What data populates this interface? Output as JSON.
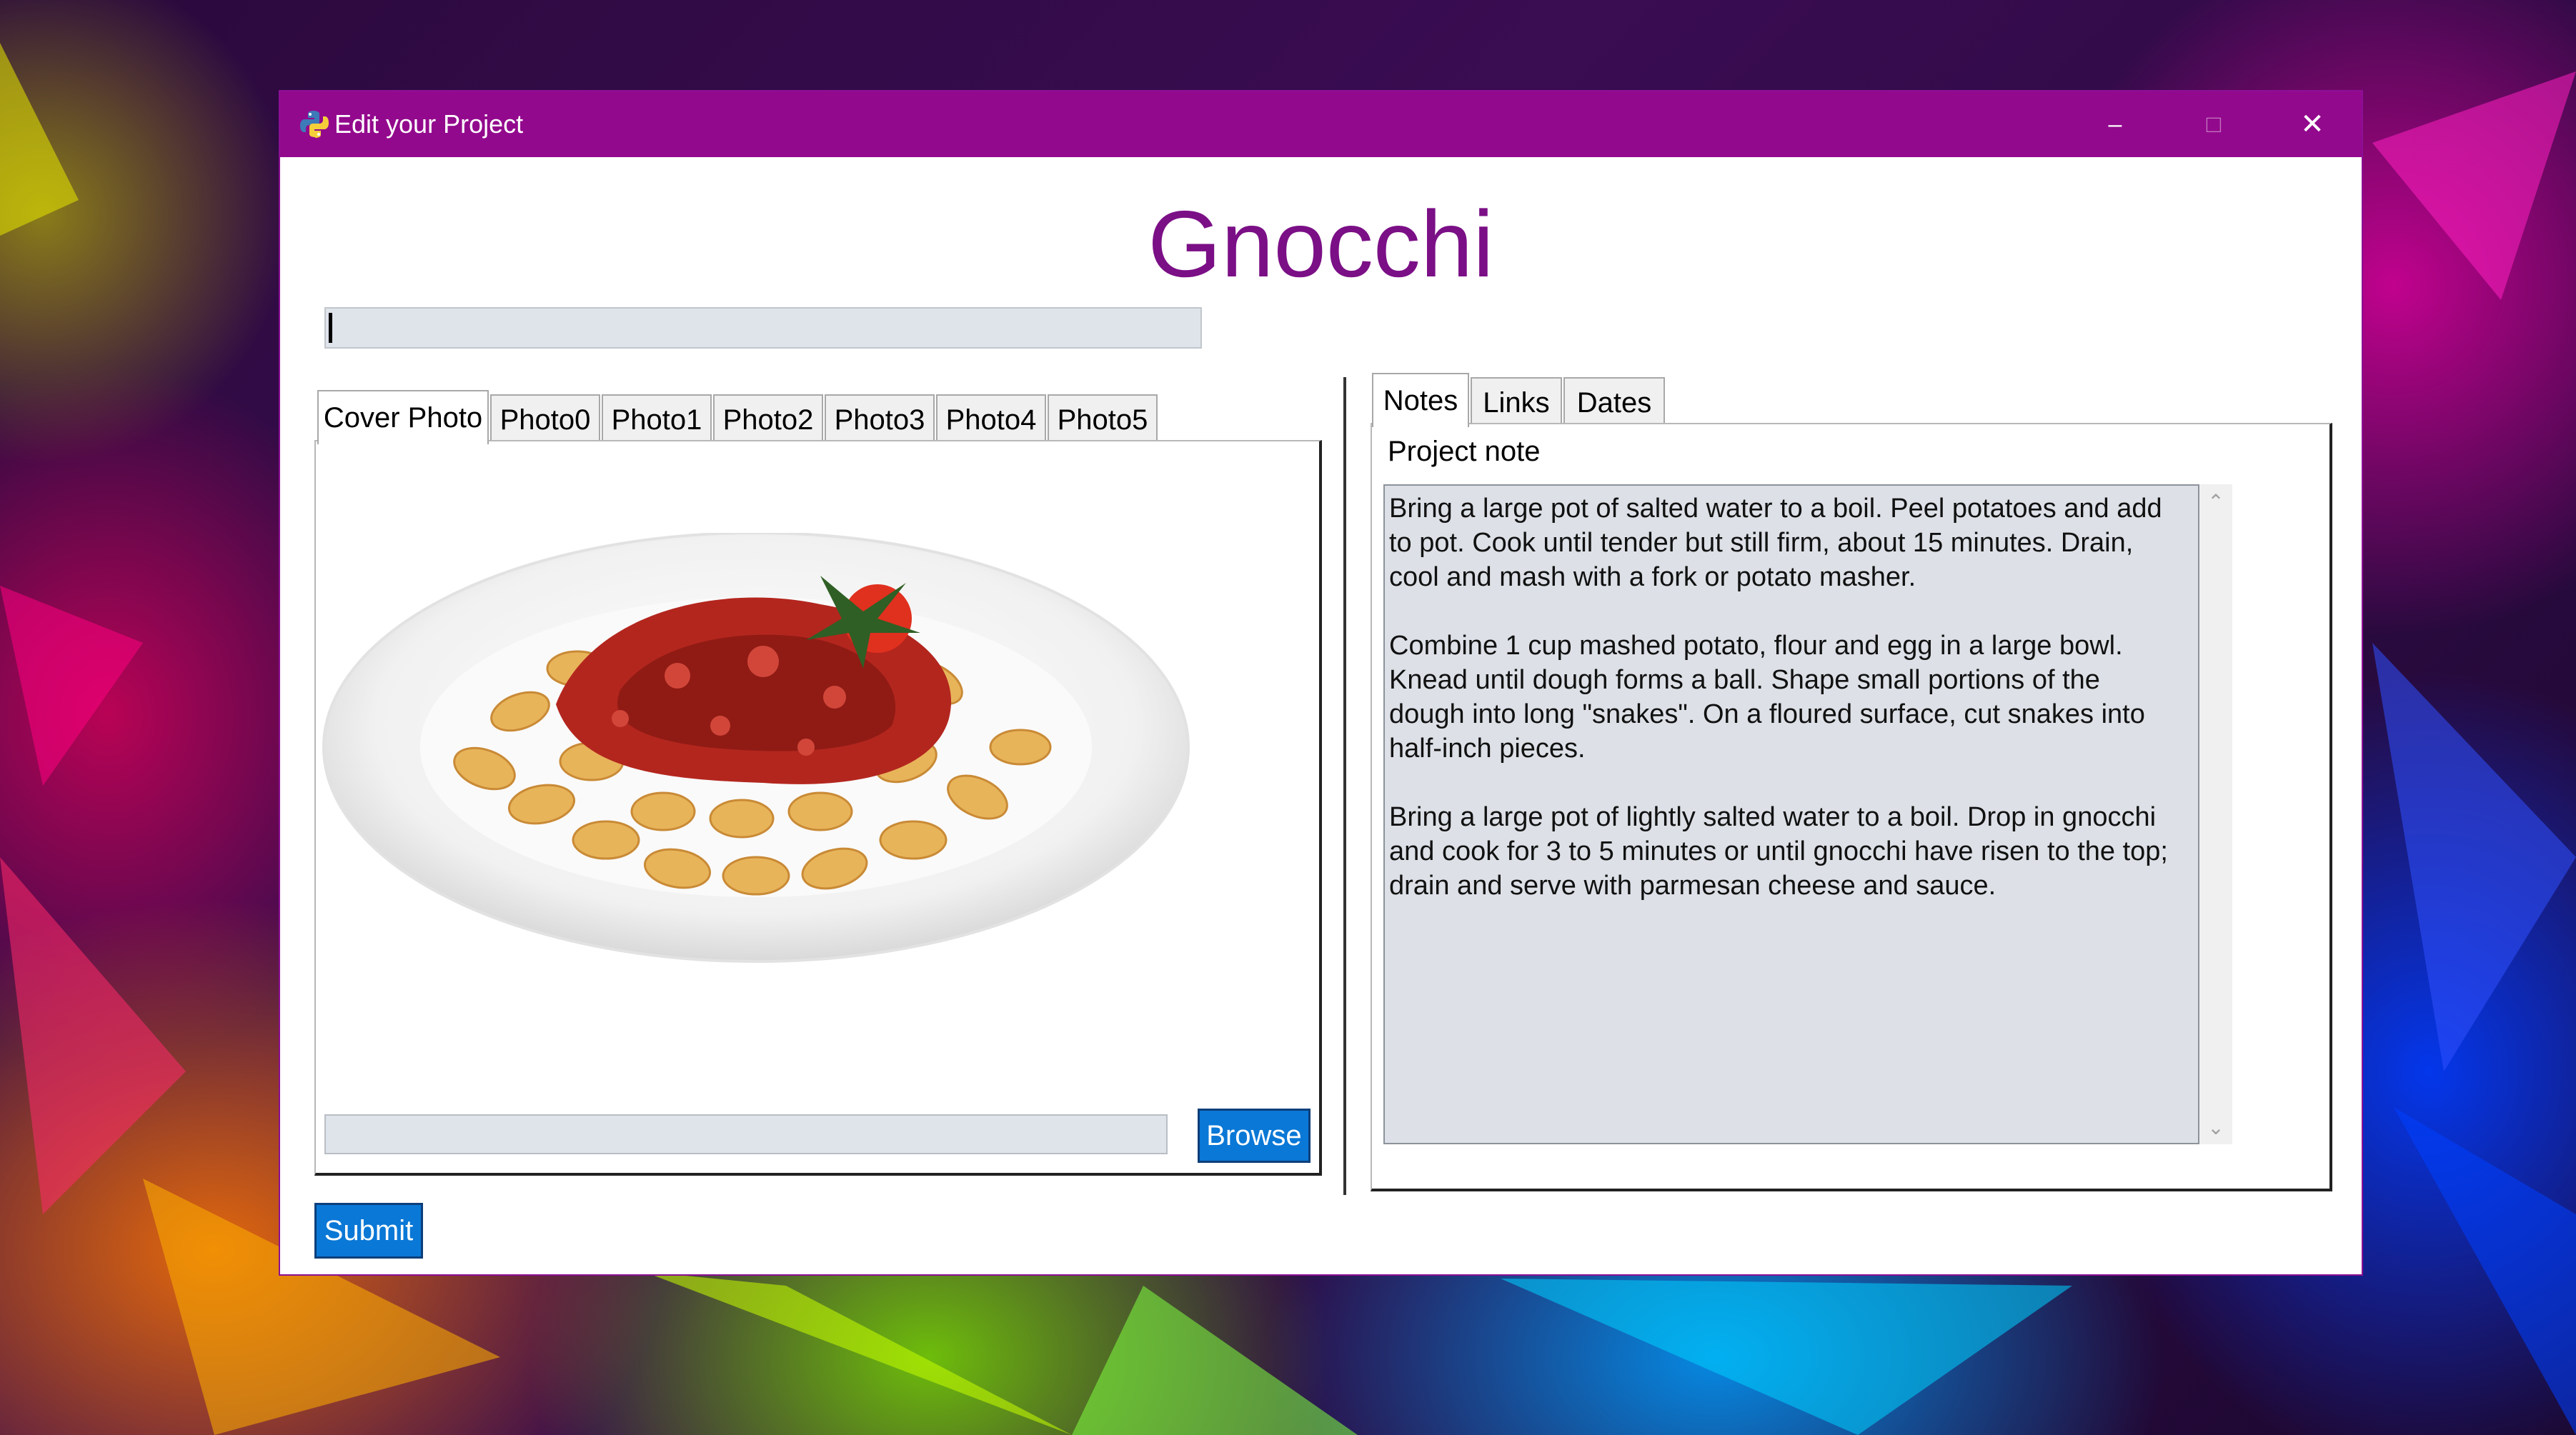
{
  "window": {
    "title": "Edit your Project",
    "controls": {
      "minimize": "–",
      "maximize": "□",
      "close": "✕"
    }
  },
  "project": {
    "name": "Gnocchi",
    "name_field_value": ""
  },
  "photo_tabs": [
    "Cover Photo",
    "Photo0",
    "Photo1",
    "Photo2",
    "Photo3",
    "Photo4",
    "Photo5"
  ],
  "photo_tab_active": "Cover Photo",
  "photo": {
    "icon": "plate-of-gnocchi-image",
    "path_value": "",
    "browse_label": "Browse"
  },
  "info_tabs": [
    "Notes",
    "Links",
    "Dates"
  ],
  "info_tab_active": "Notes",
  "notes": {
    "label": "Project note",
    "text": "Bring a large pot of salted water to a boil. Peel potatoes and add\nto pot. Cook until tender but still firm, about 15 minutes. Drain,\ncool and mash with a fork or potato masher.\n\nCombine 1 cup mashed potato, flour and egg in a large bowl.\nKnead until dough forms a ball. Shape small portions of the\ndough into long \"snakes\". On a floured surface, cut snakes into\nhalf-inch pieces.\n\nBring a large pot of lightly salted water to a boil. Drop in gnocchi\nand cook for 3 to 5 minutes or until gnocchi have risen to the top;\ndrain and serve with parmesan cheese and sauce."
  },
  "submit_label": "Submit",
  "colors": {
    "titlebar": "#93098d",
    "heading": "#7b0f86",
    "button": "#0a78d6"
  }
}
